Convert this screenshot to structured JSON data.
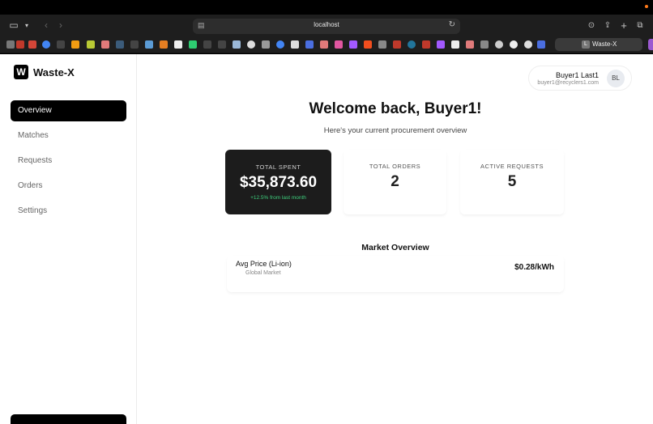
{
  "browser": {
    "url": "localhost",
    "active_tab_title": "Waste-X",
    "active_tab_favicon_letter": "L"
  },
  "app": {
    "logo_letter": "W",
    "name": "Waste-X"
  },
  "sidebar": {
    "items": [
      {
        "label": "Overview",
        "active": true
      },
      {
        "label": "Matches",
        "active": false
      },
      {
        "label": "Requests",
        "active": false
      },
      {
        "label": "Orders",
        "active": false
      },
      {
        "label": "Settings",
        "active": false
      }
    ]
  },
  "user": {
    "name": "Buyer1 Last1",
    "email": "buyer1@recyclers1.com",
    "initials": "BL"
  },
  "main": {
    "welcome": "Welcome back, Buyer1!",
    "subtitle": "Here's your current procurement overview"
  },
  "stats": {
    "total_spent": {
      "label": "TOTAL SPENT",
      "value": "$35,873.60",
      "note": "+12.5% from last month"
    },
    "total_orders": {
      "label": "TOTAL ORDERS",
      "value": "2"
    },
    "active_requests": {
      "label": "ACTIVE REQUESTS",
      "value": "5"
    }
  },
  "market": {
    "title": "Market Overview",
    "item_label": "Avg Price (Li-ion)",
    "item_sub": "Global Market",
    "item_value": "$0.28/kWh"
  },
  "colors": {
    "accent_dark": "#000000",
    "positive": "#3ecf7d",
    "card_dark": "#1c1c1c"
  },
  "icons": [
    "sidebar-toggle-icon",
    "chevron-down-icon",
    "back-icon",
    "forward-icon",
    "page-settings-icon",
    "reload-icon",
    "download-icon",
    "share-icon",
    "new-tab-icon",
    "tab-overview-icon"
  ]
}
